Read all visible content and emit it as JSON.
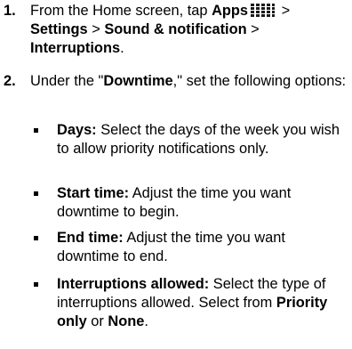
{
  "steps": [
    {
      "number": "1.",
      "part1": "From the Home screen, tap ",
      "apps_label": "Apps",
      "apps_icon": "apps-grid-icon",
      "sep1": " > ",
      "settings_label": "Settings",
      "sep2": " > ",
      "sound_label": "Sound & notification",
      "sep3": " > ",
      "interruptions_label": "Interruptions",
      "end": "."
    },
    {
      "number": "2.",
      "part1": "Under the \"",
      "downtime_label": "Downtime",
      "part2": ",\" set the following options:"
    }
  ],
  "bullets": [
    {
      "label": "Days:",
      "text": " Select the days of the week you wish to allow priority notifications only."
    },
    {
      "label": "Start time:",
      "text": " Adjust the time you want downtime to begin."
    },
    {
      "label": "End time:",
      "text": " Adjust the time you want downtime to end."
    },
    {
      "label": "Interruptions allowed:",
      "text": " Select the type of interruptions allowed. Select from ",
      "opt1": "Priority only",
      "mid": " or ",
      "opt2": "None",
      "end": "."
    }
  ]
}
